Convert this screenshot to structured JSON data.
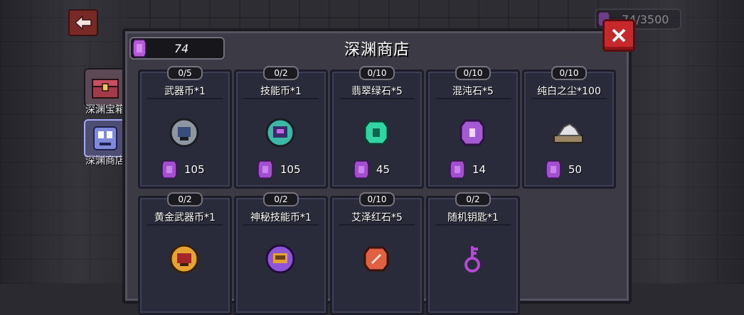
{
  "shop_title": "深渊商店",
  "currency": {
    "panel_amount": "74",
    "top_amount": "74/3500",
    "gem_color": "#b65bd8"
  },
  "side_tabs": [
    {
      "label": "深渊宝箱",
      "icon": "chest-icon"
    },
    {
      "label": "深渊商店",
      "icon": "shop-icon"
    }
  ],
  "items": [
    {
      "count": "0/5",
      "name": "武器币*1",
      "price": "105",
      "icon": "weapon-coin-icon",
      "color": "#9aa2ad"
    },
    {
      "count": "0/2",
      "name": "技能币*1",
      "price": "105",
      "icon": "skill-coin-icon",
      "color": "#3bb7a6"
    },
    {
      "count": "0/10",
      "name": "翡翠绿石*5",
      "price": "45",
      "icon": "emerald-stone-icon",
      "color": "#2fd6a4"
    },
    {
      "count": "0/10",
      "name": "混沌石*5",
      "price": "14",
      "icon": "chaos-stone-icon",
      "color": "#a45ad0"
    },
    {
      "count": "0/10",
      "name": "纯白之尘*100",
      "price": "50",
      "icon": "white-dust-icon",
      "color": "#d9d9d9"
    },
    {
      "count": "0/2",
      "name": "黄金武器币*1",
      "price": "",
      "icon": "gold-weapon-coin-icon",
      "color": "#e5a431"
    },
    {
      "count": "0/2",
      "name": "神秘技能币*1",
      "price": "",
      "icon": "mystery-skill-coin-icon",
      "color": "#8e55d6"
    },
    {
      "count": "0/10",
      "name": "艾泽红石*5",
      "price": "",
      "icon": "red-stone-icon",
      "color": "#e0603f"
    },
    {
      "count": "0/2",
      "name": "随机钥匙*1",
      "price": "",
      "icon": "random-key-icon",
      "color": "#b34ad3"
    }
  ]
}
